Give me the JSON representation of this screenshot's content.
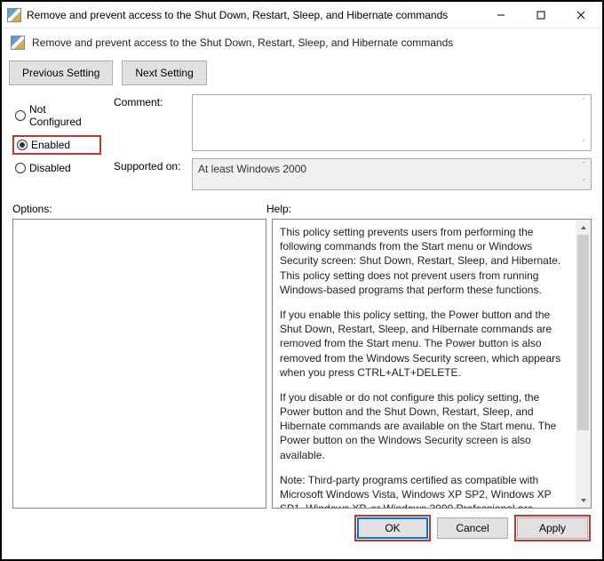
{
  "window": {
    "title": "Remove and prevent access to the Shut Down, Restart, Sleep, and Hibernate commands"
  },
  "subheader": {
    "text": "Remove and prevent access to the Shut Down, Restart, Sleep, and Hibernate commands"
  },
  "nav": {
    "previous": "Previous Setting",
    "next": "Next Setting"
  },
  "radios": {
    "not_configured": "Not Configured",
    "enabled": "Enabled",
    "disabled": "Disabled",
    "selected": "enabled"
  },
  "fields": {
    "comment_label": "Comment:",
    "comment_value": "",
    "supported_label": "Supported on:",
    "supported_value": "At least Windows 2000"
  },
  "section_labels": {
    "options": "Options:",
    "help": "Help:"
  },
  "help_paragraphs": [
    "This policy setting prevents users from performing the following commands from the Start menu or Windows Security screen: Shut Down, Restart, Sleep, and Hibernate. This policy setting does not prevent users from running Windows-based programs that perform these functions.",
    "If you enable this policy setting, the Power button and the Shut Down, Restart, Sleep, and Hibernate commands are removed from the Start menu. The Power button is also removed from the Windows Security screen, which appears when you press CTRL+ALT+DELETE.",
    "If you disable or do not configure this policy setting, the Power button and the Shut Down, Restart, Sleep, and Hibernate commands are available on the Start menu. The Power button on the Windows Security screen is also available.",
    "Note: Third-party programs certified as compatible with Microsoft Windows Vista, Windows XP SP2, Windows XP SP1, Windows XP, or Windows 2000 Professional are required to"
  ],
  "footer": {
    "ok": "OK",
    "cancel": "Cancel",
    "apply": "Apply"
  }
}
